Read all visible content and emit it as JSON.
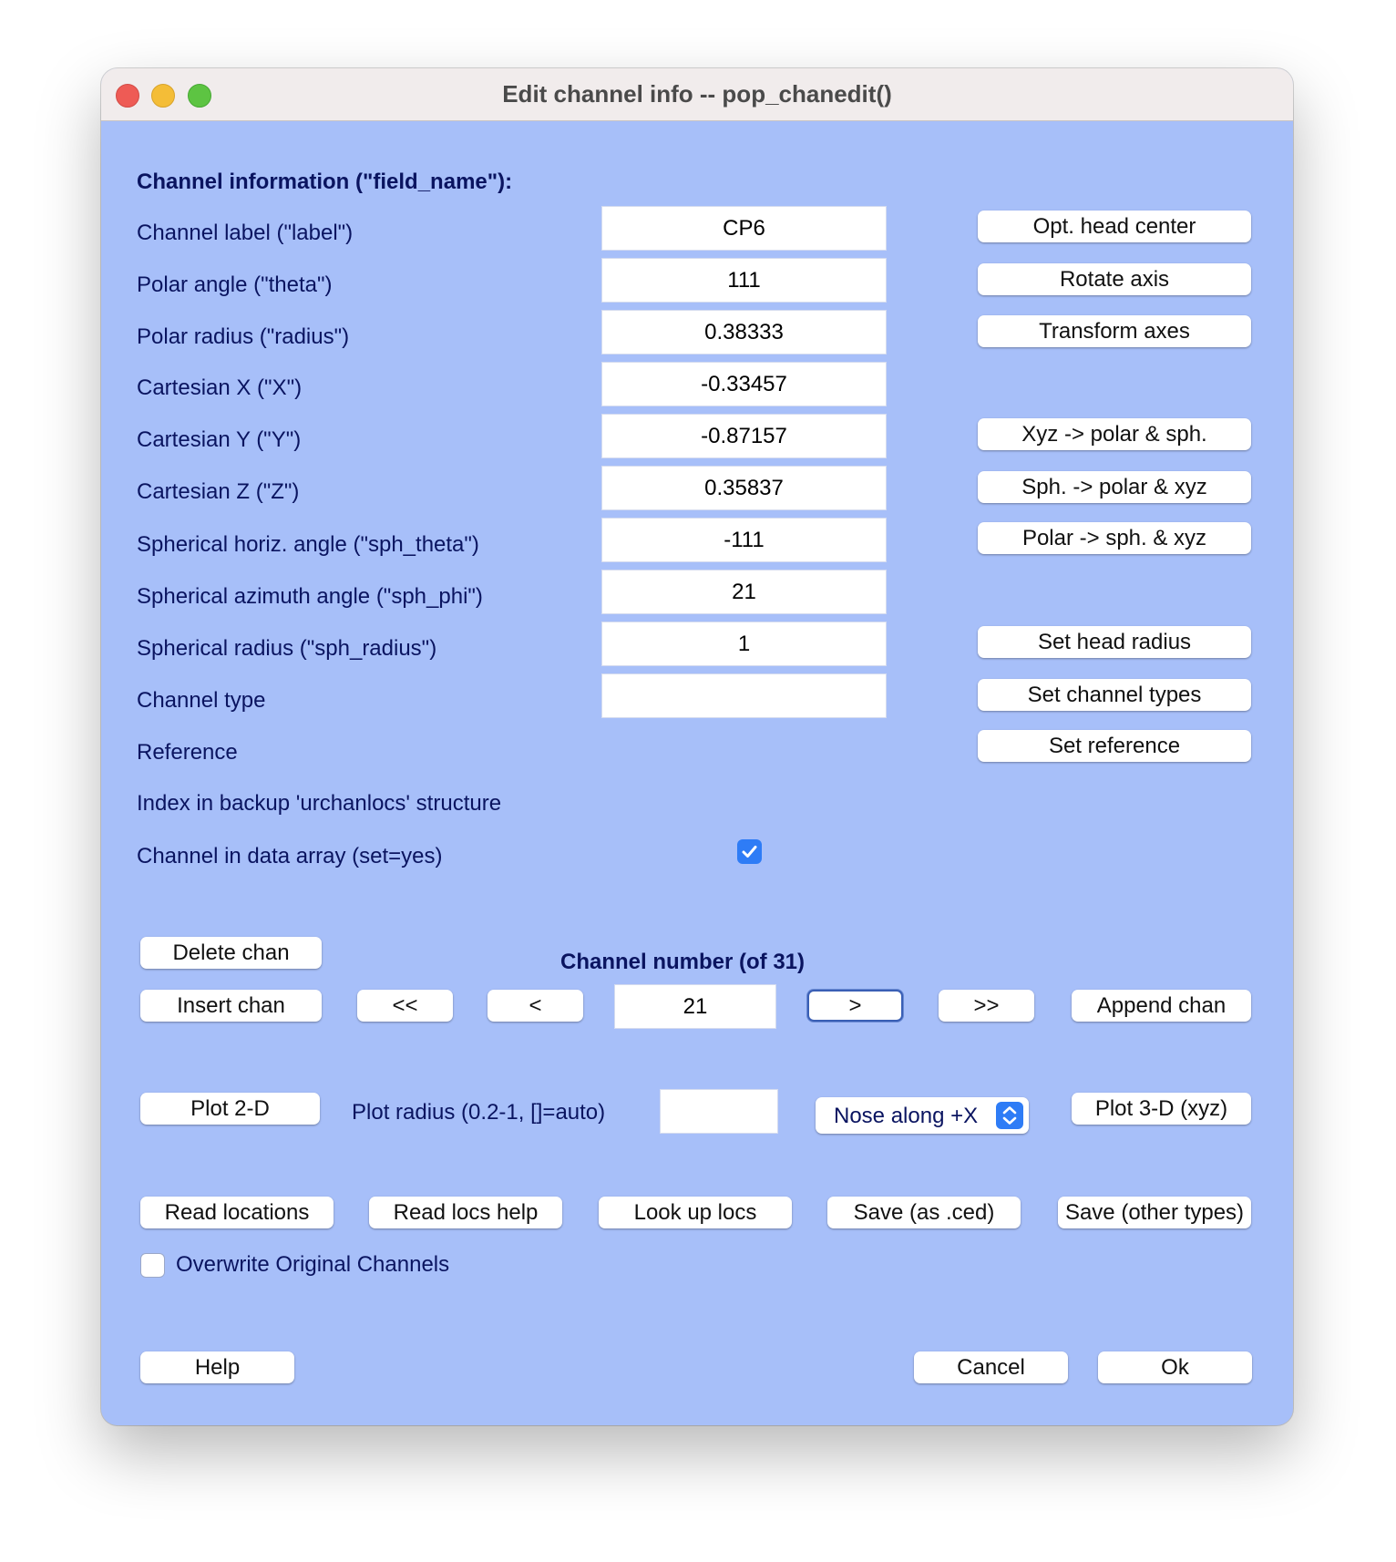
{
  "window": {
    "title": "Edit channel info -- pop_chanedit()"
  },
  "section_heading": "Channel information (\"field_name\"):",
  "fields": [
    {
      "label": "Channel label (\"label\")",
      "value": "CP6"
    },
    {
      "label": "Polar angle (\"theta\")",
      "value": "111"
    },
    {
      "label": "Polar radius (\"radius\")",
      "value": "0.38333"
    },
    {
      "label": "Cartesian X (\"X\")",
      "value": "-0.33457"
    },
    {
      "label": "Cartesian Y (\"Y\")",
      "value": "-0.87157"
    },
    {
      "label": "Cartesian Z (\"Z\")",
      "value": "0.35837"
    },
    {
      "label": "Spherical horiz. angle (\"sph_theta\")",
      "value": "-111"
    },
    {
      "label": "Spherical azimuth angle (\"sph_phi\")",
      "value": "21"
    },
    {
      "label": "Spherical radius (\"sph_radius\")",
      "value": "1"
    },
    {
      "label": "Channel type",
      "value": ""
    },
    {
      "label": "Reference"
    },
    {
      "label": "Index in backup 'urchanlocs' structure"
    },
    {
      "label": "Channel in data array (set=yes)"
    }
  ],
  "channel_in_data_array": true,
  "side_buttons": {
    "opt_head_center": "Opt. head center",
    "rotate_axis": "Rotate axis",
    "transform_axes": "Transform axes",
    "xyz_to_polar": "Xyz -> polar & sph.",
    "sph_to_polar": "Sph. -> polar & xyz",
    "polar_to_sph": "Polar -> sph. & xyz",
    "set_head_radius": "Set head radius",
    "set_channel_types": "Set channel types",
    "set_reference": "Set reference"
  },
  "navigation": {
    "delete_chan": "Delete chan",
    "insert_chan": "Insert chan",
    "channel_number_label": "Channel number (of 31)",
    "first": "<<",
    "prev": "<",
    "channel_number": "21",
    "next": ">",
    "last": ">>",
    "append_chan": "Append chan"
  },
  "plot": {
    "plot_2d": "Plot 2-D",
    "radius_label": "Plot radius (0.2-1, []=auto)",
    "radius_value": "",
    "nose_option": "Nose along +X",
    "plot_3d": "Plot 3-D (xyz)"
  },
  "file_buttons": {
    "read_locations": "Read locations",
    "read_locs_help": "Read locs help",
    "look_up_locs": "Look up locs",
    "save_ced": "Save (as .ced)",
    "save_other": "Save (other types)"
  },
  "overwrite": {
    "label": "Overwrite Original Channels",
    "checked": false
  },
  "footer": {
    "help": "Help",
    "cancel": "Cancel",
    "ok": "Ok"
  }
}
